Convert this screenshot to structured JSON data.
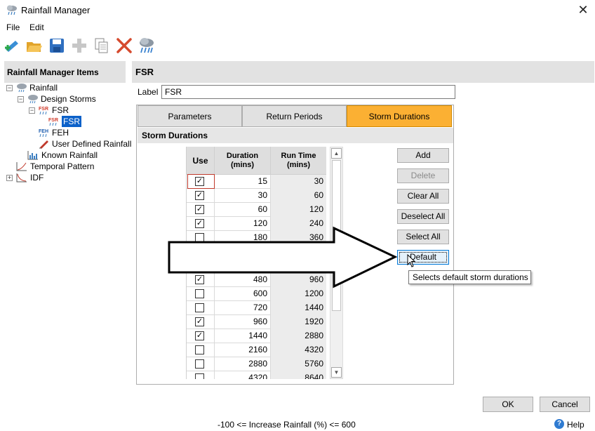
{
  "window": {
    "title": "Rainfall Manager",
    "close_glyph": "✕"
  },
  "menu": [
    {
      "label": "File"
    },
    {
      "label": "Edit"
    }
  ],
  "toolbar": {
    "icons": [
      "new-icon",
      "open-folder-icon",
      "save-icon",
      "add-icon",
      "copy-icon",
      "delete-icon",
      "rainfall-icon"
    ]
  },
  "left_panel": {
    "header": "Rainfall Manager Items",
    "tree": {
      "rainfall": "Rainfall",
      "design_storms": "Design Storms",
      "fsr": "FSR",
      "fsr_child": "FSR",
      "feh": "FEH",
      "user_defined": "User Defined Rainfall",
      "known_rainfall": "Known Rainfall",
      "temporal_pattern": "Temporal Pattern",
      "idf": "IDF",
      "fsr_icon_text": "FSR",
      "feh_icon_text": "FEH"
    }
  },
  "right_panel": {
    "header": "FSR",
    "label_caption": "Label",
    "label_value": "FSR",
    "tabs": [
      {
        "label": "Parameters",
        "active": false
      },
      {
        "label": "Return Periods",
        "active": false
      },
      {
        "label": "Storm Durations",
        "active": true
      }
    ],
    "section_title": "Storm Durations",
    "grid": {
      "headers": {
        "use": "Use",
        "duration": "Duration (mins)",
        "runtime": "Run Time (mins)"
      },
      "rows": [
        {
          "checked": true,
          "duration": "15",
          "runtime": "30"
        },
        {
          "checked": true,
          "duration": "30",
          "runtime": "60"
        },
        {
          "checked": true,
          "duration": "60",
          "runtime": "120"
        },
        {
          "checked": true,
          "duration": "120",
          "runtime": "240"
        },
        {
          "checked": false,
          "duration": "180",
          "runtime": "360"
        },
        {
          "checked": false,
          "duration": "",
          "runtime": ""
        },
        {
          "checked": false,
          "duration": "",
          "runtime": ""
        },
        {
          "checked": true,
          "duration": "480",
          "runtime": "960"
        },
        {
          "checked": false,
          "duration": "600",
          "runtime": "1200"
        },
        {
          "checked": false,
          "duration": "720",
          "runtime": "1440"
        },
        {
          "checked": true,
          "duration": "960",
          "runtime": "1920"
        },
        {
          "checked": true,
          "duration": "1440",
          "runtime": "2880"
        },
        {
          "checked": false,
          "duration": "2160",
          "runtime": "4320"
        },
        {
          "checked": false,
          "duration": "2880",
          "runtime": "5760"
        },
        {
          "checked": false,
          "duration": "4320",
          "runtime": "8640"
        }
      ]
    },
    "buttons": {
      "add": "Add",
      "delete": "Delete",
      "clear_all": "Clear All",
      "deselect_all": "Deselect All",
      "select_all": "Select All",
      "default": "Default"
    },
    "tooltip": "Selects default storm durations"
  },
  "footer": {
    "ok": "OK",
    "cancel": "Cancel",
    "status": "-100 <= Increase Rainfall (%) <= 600",
    "help": "Help",
    "help_glyph": "?"
  },
  "colors": {
    "active_tab": "#fbb033",
    "selection": "#0c61c9"
  }
}
